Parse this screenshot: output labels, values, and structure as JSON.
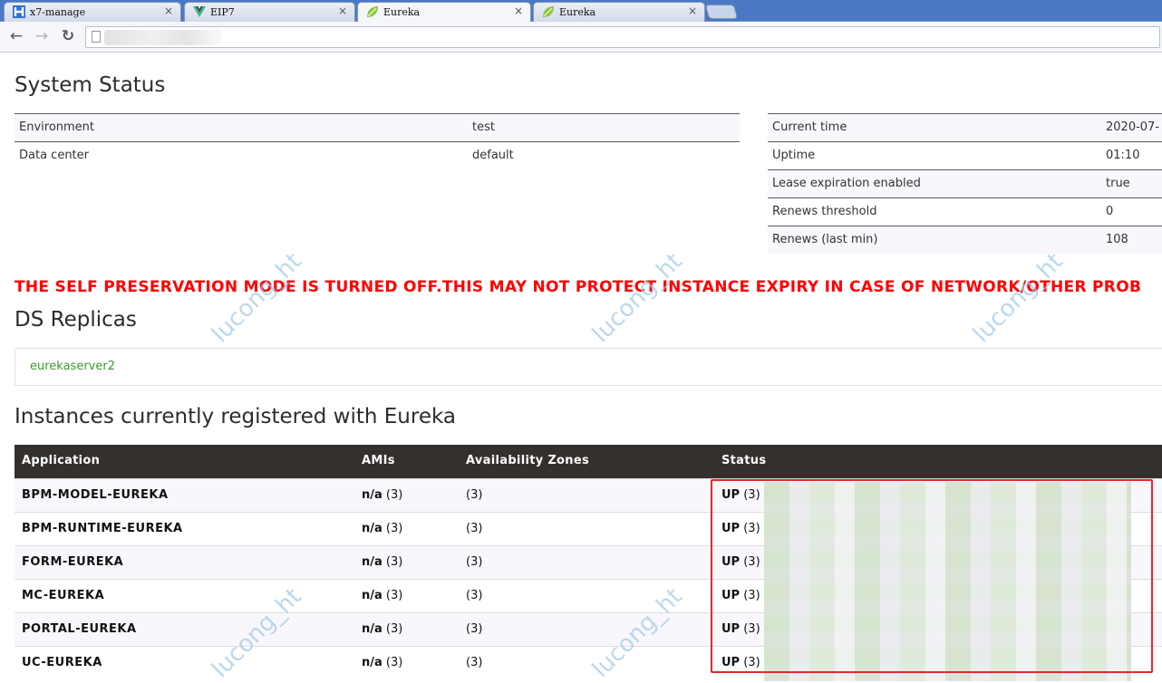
{
  "browser": {
    "tabs": [
      {
        "title": "x7-manage",
        "icon": "h-logo-icon",
        "active": false
      },
      {
        "title": "EIP7",
        "icon": "vue-logo-icon",
        "active": false
      },
      {
        "title": "Eureka",
        "icon": "spring-leaf-icon",
        "active": true
      },
      {
        "title": "Eureka",
        "icon": "spring-leaf-icon",
        "active": false
      }
    ],
    "close_glyph": "×",
    "nav": {
      "back": "←",
      "forward": "→",
      "reload": "↻"
    },
    "address": ""
  },
  "system_status": {
    "heading": "System Status",
    "left": [
      {
        "key": "Environment",
        "value": "test"
      },
      {
        "key": "Data center",
        "value": "default"
      }
    ],
    "right": [
      {
        "key": "Current time",
        "value": "2020-07-"
      },
      {
        "key": "Uptime",
        "value": "01:10"
      },
      {
        "key": "Lease expiration enabled",
        "value": "true"
      },
      {
        "key": "Renews threshold",
        "value": "0"
      },
      {
        "key": "Renews (last min)",
        "value": "108"
      }
    ]
  },
  "warning": "THE SELF PRESERVATION MODE IS TURNED OFF.THIS MAY NOT PROTECT INSTANCE EXPIRY IN CASE OF NETWORK/OTHER PROB",
  "replicas": {
    "heading": "DS Replicas",
    "items": [
      "eurekaserver2"
    ]
  },
  "instances": {
    "heading": "Instances currently registered with Eureka",
    "columns": [
      "Application",
      "AMIs",
      "Availability Zones",
      "Status"
    ],
    "rows": [
      {
        "app": "BPM-MODEL-EUREKA",
        "ami": "n/a",
        "ami_count": "(3)",
        "zones": "(3)",
        "status": "UP",
        "status_count": "(3) -"
      },
      {
        "app": "BPM-RUNTIME-EUREKA",
        "ami": "n/a",
        "ami_count": "(3)",
        "zones": "(3)",
        "status": "UP",
        "status_count": "(3)"
      },
      {
        "app": "FORM-EUREKA",
        "ami": "n/a",
        "ami_count": "(3)",
        "zones": "(3)",
        "status": "UP",
        "status_count": "(3)"
      },
      {
        "app": "MC-EUREKA",
        "ami": "n/a",
        "ami_count": "(3)",
        "zones": "(3)",
        "status": "UP",
        "status_count": "(3) -"
      },
      {
        "app": "PORTAL-EUREKA",
        "ami": "n/a",
        "ami_count": "(3)",
        "zones": "(3)",
        "status": "UP",
        "status_count": "(3) -"
      },
      {
        "app": "UC-EUREKA",
        "ami": "n/a",
        "ami_count": "(3)",
        "zones": "(3)",
        "status": "UP",
        "status_count": "(3) -"
      }
    ]
  },
  "watermark": "lucong_ht",
  "colors": {
    "warning": "#ff0000",
    "table_header": "#34302d",
    "link": "#3a9a2a",
    "highlight_box": "#e8262b"
  }
}
